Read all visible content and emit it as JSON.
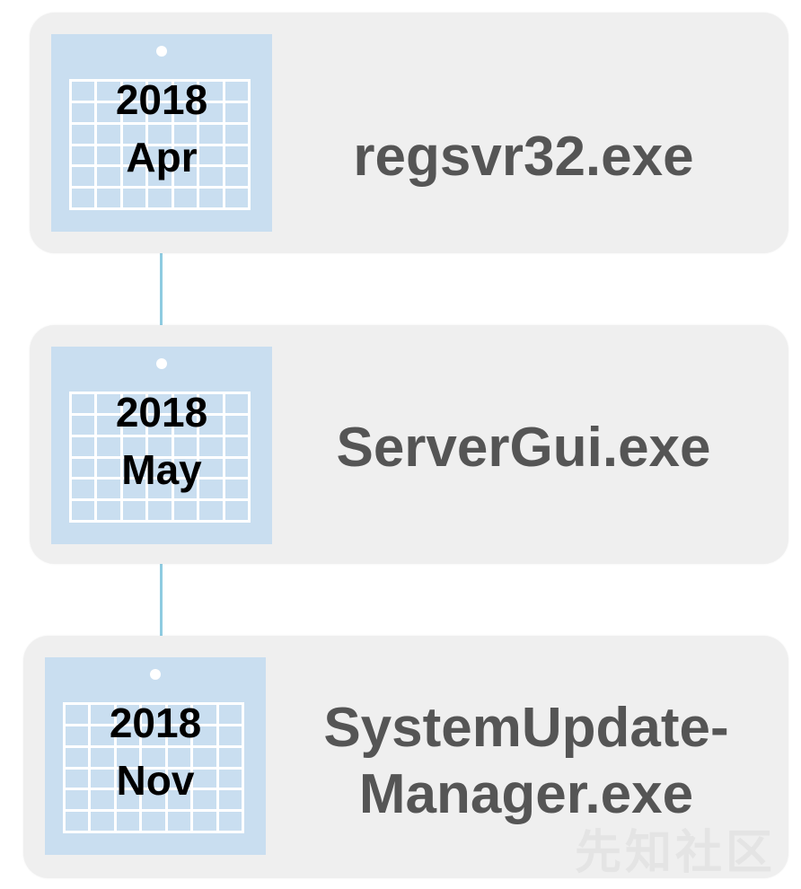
{
  "timeline": {
    "items": [
      {
        "year": "2018",
        "month": "Apr",
        "file": "regsvr32.exe"
      },
      {
        "year": "2018",
        "month": "May",
        "file": "ServerGui.exe"
      },
      {
        "year": "2018",
        "month": "Nov",
        "file_line1": "SystemUpdate-",
        "file_line2": "Manager.exe"
      }
    ]
  },
  "colors": {
    "card": "#efefef",
    "calendar": "#c9def0",
    "connector": "#8ecbe0",
    "label": "#555555"
  },
  "watermark": "先知社区"
}
